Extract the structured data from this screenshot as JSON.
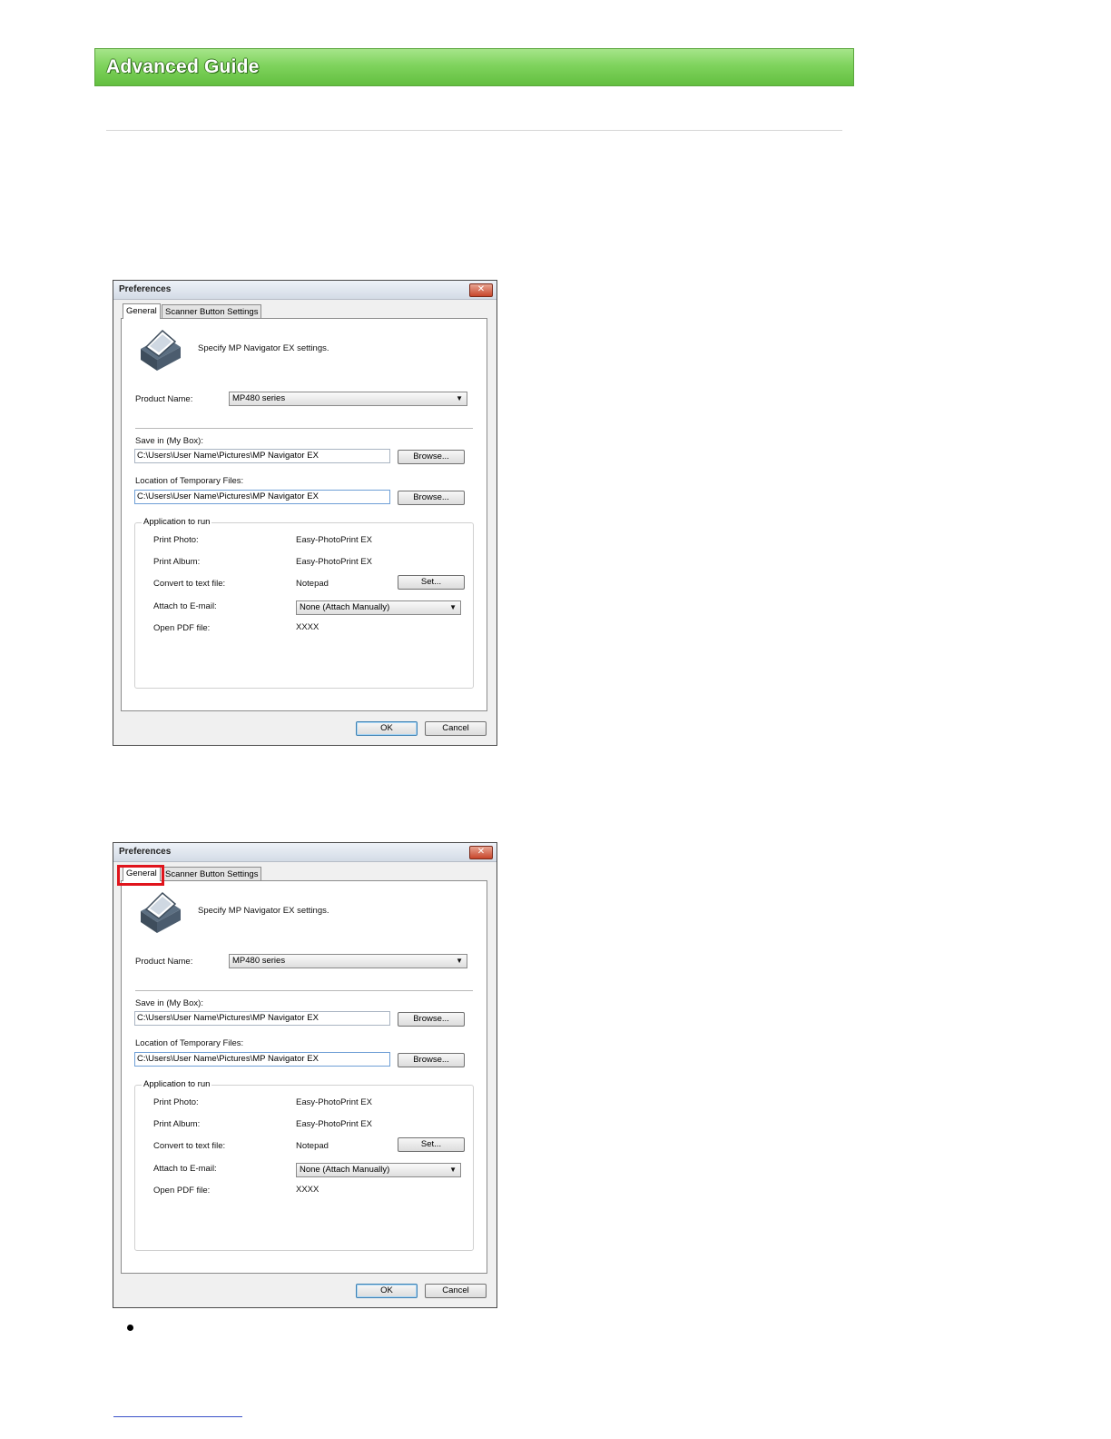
{
  "header": {
    "title": "Advanced Guide"
  },
  "dialogs": [
    {
      "title": "Preferences",
      "close_glyph": "✕",
      "tabs": [
        "General",
        "Scanner Button Settings"
      ],
      "description": "Specify MP Navigator EX settings.",
      "product_name_label": "Product Name:",
      "product_name_value": "MP480 series",
      "save_in_label": "Save in (My Box):",
      "save_in_value": "C:\\Users\\User Name\\Pictures\\MP Navigator EX",
      "browse_label": "Browse...",
      "temp_label": "Location of Temporary Files:",
      "temp_value": "C:\\Users\\User Name\\Pictures\\MP Navigator EX",
      "group_title": "Application to run",
      "rows": {
        "print_photo_label": "Print Photo:",
        "print_photo_value": "Easy-PhotoPrint EX",
        "print_album_label": "Print Album:",
        "print_album_value": "Easy-PhotoPrint EX",
        "convert_label": "Convert to text file:",
        "convert_value": "Notepad",
        "set_label": "Set...",
        "email_label": "Attach to E-mail:",
        "email_value": "None (Attach Manually)",
        "pdf_label": "Open PDF file:",
        "pdf_value": "XXXX"
      },
      "ok_label": "OK",
      "cancel_label": "Cancel"
    },
    {
      "title": "Preferences",
      "close_glyph": "✕",
      "tabs": [
        "General",
        "Scanner Button Settings"
      ],
      "description": "Specify MP Navigator EX settings.",
      "product_name_label": "Product Name:",
      "product_name_value": "MP480 series",
      "save_in_label": "Save in (My Box):",
      "save_in_value": "C:\\Users\\User Name\\Pictures\\MP Navigator EX",
      "browse_label": "Browse...",
      "temp_label": "Location of Temporary Files:",
      "temp_value": "C:\\Users\\User Name\\Pictures\\MP Navigator EX",
      "group_title": "Application to run",
      "rows": {
        "print_photo_label": "Print Photo:",
        "print_photo_value": "Easy-PhotoPrint EX",
        "print_album_label": "Print Album:",
        "print_album_value": "Easy-PhotoPrint EX",
        "convert_label": "Convert to text file:",
        "convert_value": "Notepad",
        "set_label": "Set...",
        "email_label": "Attach to E-mail:",
        "email_value": "None (Attach Manually)",
        "pdf_label": "Open PDF file:",
        "pdf_value": "XXXX"
      },
      "ok_label": "OK",
      "cancel_label": "Cancel",
      "highlight": "General tab",
      "highlight_color": "#e0141c"
    }
  ],
  "colors": {
    "banner": "#7fd35d",
    "link_rule": "#3a52c8"
  }
}
